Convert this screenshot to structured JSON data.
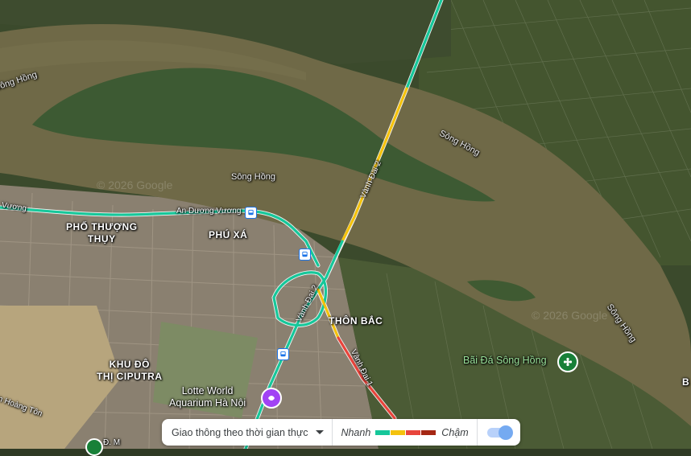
{
  "labels": {
    "pho_thuong_thuy": [
      "PHỐ THƯỢNG",
      "THỤY"
    ],
    "phu_xa": "PHÚ XÁ",
    "thon_bac": "THÔN BẮC",
    "khu_do_thi": [
      "KHU ĐÔ",
      "THỊ CIPUTRA"
    ],
    "b_edge": "B"
  },
  "rivers": [
    "Sông Hồng",
    "Sông Hồng",
    "Sông Hồng",
    "Sông Hồng"
  ],
  "roads": {
    "an_duong_vuong": "An Dương Vương",
    "vuong_left": "Vương",
    "vanh_dai_2_a": "Vành Đai 2",
    "vanh_dai_2_b": "Vành Đai 2",
    "vanh_dai_1": "Vành Đai 1",
    "hoang_ton": "n Hoàng Tôn",
    "d_m": "Đ. M"
  },
  "pois": {
    "lotte": [
      "Lotte World",
      "Aquarium Hà Nội"
    ],
    "bai_da": "Bãi Đá Sông Hồng"
  },
  "watermark": [
    "© 2026 Google",
    "© 2026 Google"
  ],
  "icons": {
    "bus": "bus-stop-icon",
    "lotte": "aquarium-pin-icon",
    "bai_da": "flower-pin-icon"
  },
  "legend": {
    "mode_label": "Giao thông theo thời gian thực",
    "fast": "Nhanh",
    "slow": "Chậm",
    "colors": [
      "#16c79a",
      "#f4c20d",
      "#e8453c",
      "#a52714"
    ],
    "toggle_on": true
  }
}
